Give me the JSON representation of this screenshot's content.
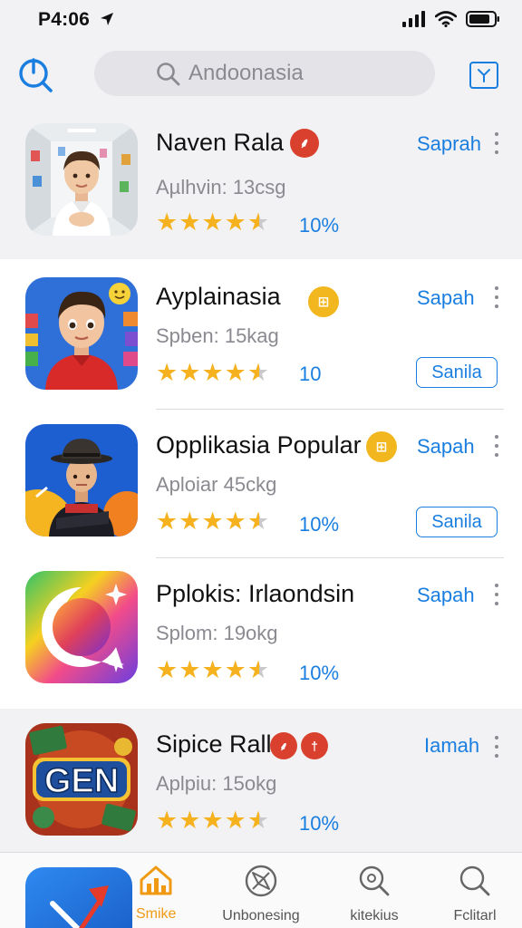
{
  "status_bar": {
    "time": "P4:06"
  },
  "search": {
    "placeholder": "Andoonasia"
  },
  "colors": {
    "accent": "#1a7ee0",
    "star": "#f5b21e",
    "tab_active": "#f09a14",
    "badge_red": "#d9412e",
    "badge_yellow": "#f2b71f"
  },
  "apps": [
    {
      "title": "Naven Rala",
      "subtitle": "Aµlhvin: 13csg",
      "rating": 4.5,
      "rating_text": "10%",
      "action": "Saprah",
      "badges": [
        {
          "glyph": "⸙",
          "color": "red"
        }
      ]
    },
    {
      "title": "Ayplainasia",
      "subtitle": "Spben: 15kag",
      "rating": 4.5,
      "rating_text": "10",
      "action": "Sapah",
      "install": "Sanila",
      "badges": [
        {
          "glyph": "⊞",
          "color": "yellow"
        }
      ]
    },
    {
      "title": "Opplikasia Popular",
      "subtitle": "Aploiar 45ckg",
      "rating": 4.5,
      "rating_text": "10%",
      "action": "Sapah",
      "install": "Sanila",
      "badges": [
        {
          "glyph": "⊞",
          "color": "yellow"
        }
      ]
    },
    {
      "title": "Pplokis: Irlaondsin",
      "subtitle": "Splom: 19okg",
      "rating": 4.5,
      "rating_text": "10%",
      "action": "Sapah"
    },
    {
      "title": "Sipice Rall",
      "subtitle": "Aplpiu: 15okg",
      "rating": 4.5,
      "rating_text": "10%",
      "action": "Iamah",
      "icon_text": "GEN",
      "badges": [
        {
          "glyph": "⸙",
          "color": "red"
        },
        {
          "glyph": "†",
          "color": "red"
        }
      ]
    }
  ],
  "tabs": [
    {
      "label": "Smike",
      "icon": "home-icon",
      "active": true
    },
    {
      "label": "Unbonesing",
      "icon": "compass-icon"
    },
    {
      "label": "kitekius",
      "icon": "search-icon"
    },
    {
      "label": "Fclitarl",
      "icon": "search-icon"
    }
  ]
}
